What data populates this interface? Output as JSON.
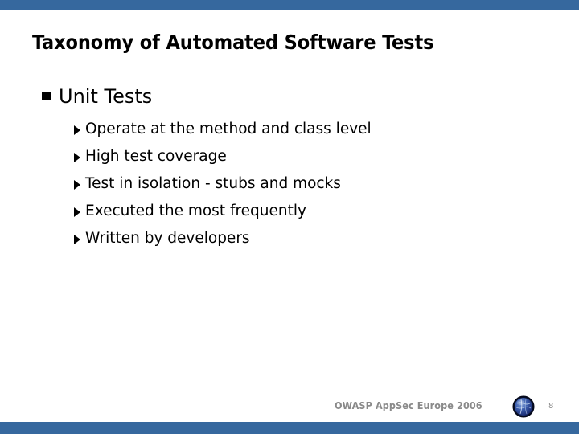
{
  "slide": {
    "title": "Taxonomy of Automated Software Tests",
    "accent_color": "#36689e",
    "background_color": "#ffffff",
    "text_color": "#000000",
    "footer_color": "#8a8a8a"
  },
  "content": {
    "level1": {
      "bullet_icon": "square-bullet-icon",
      "label": "Unit Tests"
    },
    "level2": {
      "bullet_icon": "triangle-bullet-icon",
      "items": [
        {
          "label": "Operate at the method and class level"
        },
        {
          "label": "High test coverage"
        },
        {
          "label": "Test in isolation - stubs and mocks"
        },
        {
          "label": "Executed the most frequently"
        },
        {
          "label": "Written by developers"
        }
      ]
    }
  },
  "footer": {
    "conference": "OWASP AppSec Europe 2006",
    "logo_icon": "owasp-globe-logo-icon",
    "page_number": "8"
  }
}
